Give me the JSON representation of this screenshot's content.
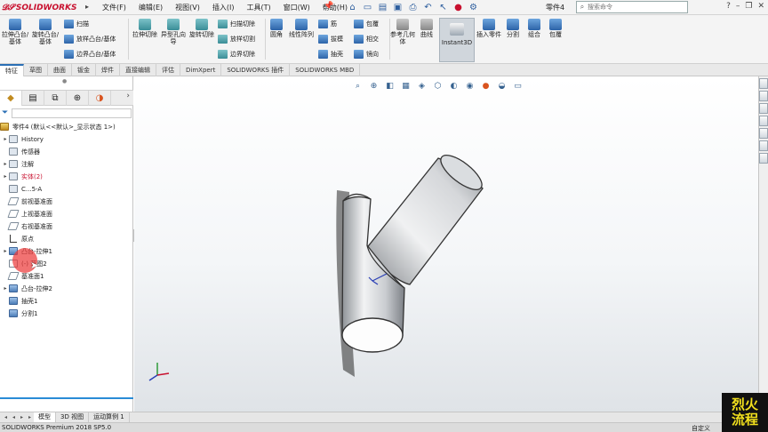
{
  "app": {
    "brand": "SOLIDWORKS",
    "document_name": "零件4",
    "brand_color": "#c8102e",
    "accent_color": "#2a6fb5"
  },
  "menu": [
    "文件(F)",
    "编辑(E)",
    "视图(V)",
    "插入(I)",
    "工具(T)",
    "窗口(W)",
    "帮助(H)"
  ],
  "search": {
    "placeholder": "搜索命令"
  },
  "quick_tools": [
    "home-icon",
    "new-icon",
    "open-icon",
    "save-icon",
    "print-icon",
    "undo-icon",
    "select-icon",
    "traffic-light-icon",
    "options-icon"
  ],
  "commands": {
    "extrude_boss": "拉伸凸台/基体",
    "revolve_boss": "旋转凸台/基体",
    "sweep": "扫描",
    "loft": "放样凸台/基体",
    "boundary_boss": "边界凸台/基体",
    "extrude_cut": "拉伸切除",
    "hole_wizard": "异型孔向导",
    "revolve_cut": "旋转切除",
    "swept_cut": "扫描切除",
    "lofted_cut": "放样切割",
    "boundary_cut": "边界切除",
    "fillet": "圆角",
    "linear_pattern": "线性阵列",
    "rib": "筋",
    "draft": "拔模",
    "shell": "抽壳",
    "wrap": "包覆",
    "intersect": "相交",
    "mirror": "镜向",
    "ref_geometry": "参考几何体",
    "curves": "曲线",
    "instant3d": "Instant3D",
    "insert_part": "插入零件",
    "split": "分割",
    "combine": "组合",
    "wrap2": "包覆"
  },
  "tabs": [
    "特征",
    "草图",
    "曲面",
    "钣金",
    "焊件",
    "直接编辑",
    "评估",
    "DimXpert",
    "SOLIDWORKS 插件",
    "SOLIDWORKS MBD"
  ],
  "feature_tree": {
    "root": "零件4 (默认<<默认>_显示状态 1>)",
    "items": [
      {
        "label": "History",
        "icon": "history-icon",
        "expandable": true
      },
      {
        "label": "传感器",
        "icon": "sensor-icon",
        "expandable": false
      },
      {
        "label": "注解",
        "icon": "annotation-icon",
        "expandable": true
      },
      {
        "label": "实体(2)",
        "icon": "solid-bodies-icon",
        "expandable": true
      },
      {
        "label": "C...5-A",
        "icon": "material-icon",
        "expandable": false
      },
      {
        "label": "前视基准面",
        "icon": "plane-icon",
        "expandable": false
      },
      {
        "label": "上视基准面",
        "icon": "plane-icon",
        "expandable": false
      },
      {
        "label": "右视基准面",
        "icon": "plane-icon",
        "expandable": false
      },
      {
        "label": "原点",
        "icon": "origin-icon",
        "expandable": false
      },
      {
        "label": "凸台-拉伸1",
        "icon": "extrude-icon",
        "expandable": true
      },
      {
        "label": "(-) 草图2",
        "icon": "sketch-icon",
        "expandable": false
      },
      {
        "label": "基准面1",
        "icon": "plane-icon",
        "expandable": false
      },
      {
        "label": "凸台-拉伸2",
        "icon": "extrude-icon",
        "expandable": true
      },
      {
        "label": "抽壳1",
        "icon": "shell-icon",
        "expandable": false
      },
      {
        "label": "分割1",
        "icon": "split-icon",
        "expandable": false
      }
    ]
  },
  "bottom_tabs": [
    "模型",
    "3D 视图",
    "运动算例 1"
  ],
  "status": {
    "left": "SOLIDWORKS Premium 2018 SP5.0",
    "right": "自定义"
  },
  "watermark": {
    "line1": "烈火",
    "line2": "流程"
  }
}
